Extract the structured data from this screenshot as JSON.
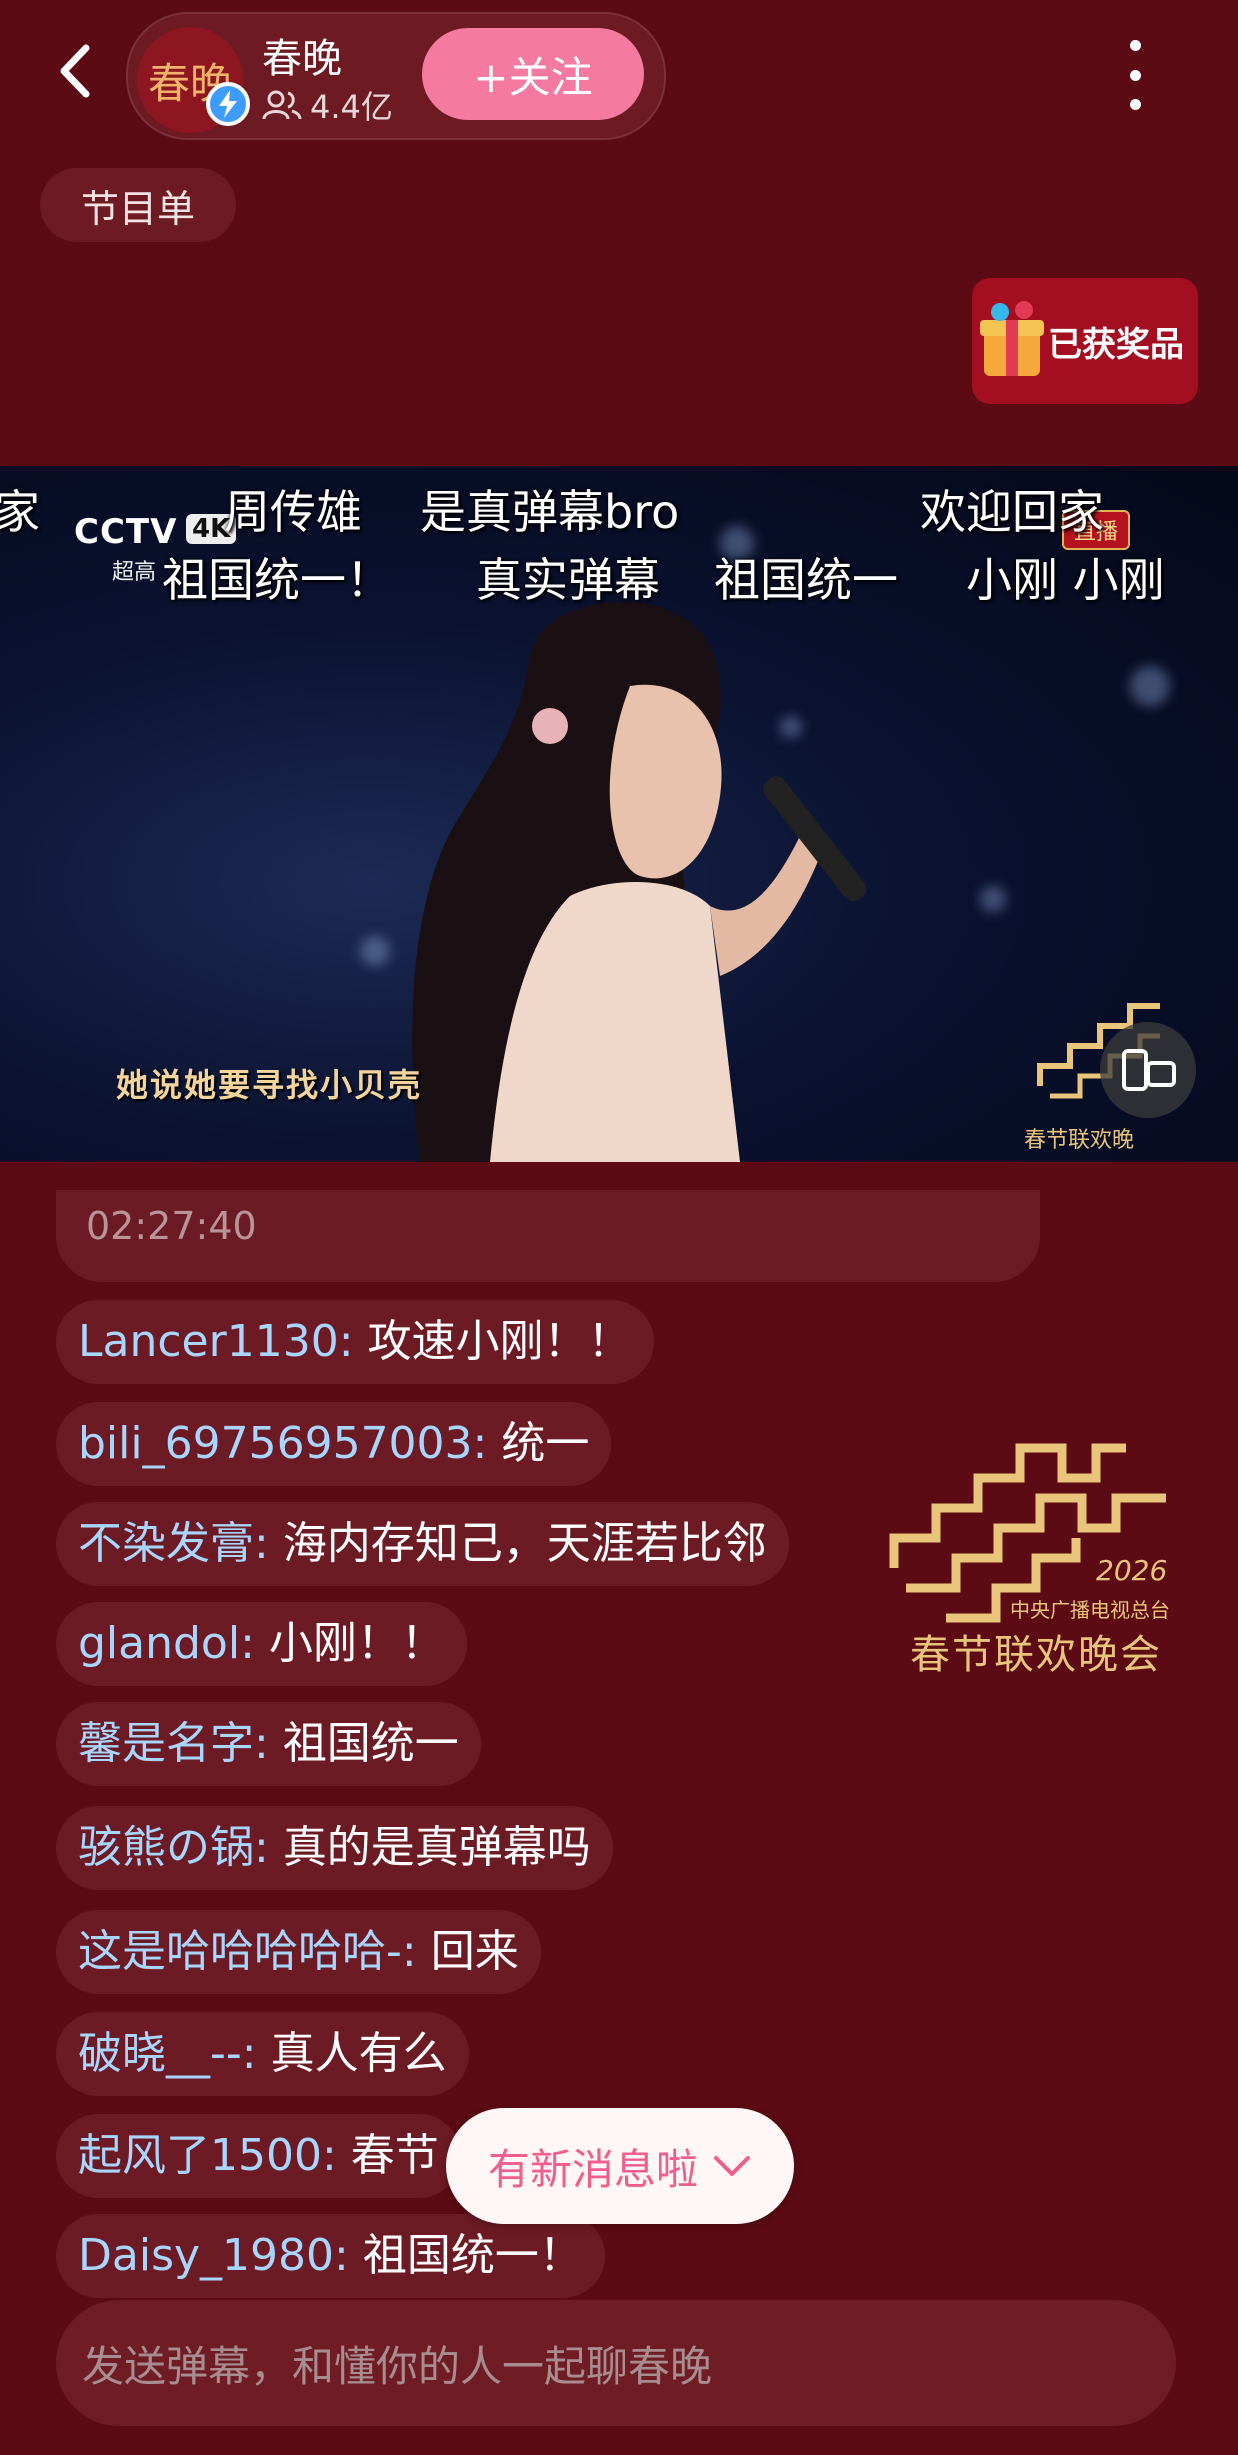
{
  "header": {
    "channel_name": "春晚",
    "avatar_text": "春晚",
    "followers": "4.4亿",
    "follow_label": "+关注"
  },
  "program_list_label": "节目单",
  "prize_label": "已获奖品",
  "video": {
    "danmaku": [
      "家",
      "周传雄",
      "是真弹幕bro",
      "欢迎回家",
      "祖国统一！",
      "真实弹幕",
      "祖国统一",
      "小刚 小刚"
    ],
    "channel_logo": "CCTV",
    "channel_logo_4k": "4K",
    "channel_logo_sub": "超高",
    "live_badge": "直播",
    "subtitle": "她说她要寻找小贝壳",
    "watermark": "春节联欢晚"
  },
  "chat": {
    "partial_timestamp": "02:27:40",
    "messages": [
      {
        "user": "Lancer1130",
        "text": "攻速小刚！！"
      },
      {
        "user": "bili_69756957003",
        "text": "统一"
      },
      {
        "user": "不染发膏",
        "text": "海内存知己，天涯若比邻"
      },
      {
        "user": "glandol",
        "text": "小刚！！"
      },
      {
        "user": "馨是名字",
        "text": "祖国统一"
      },
      {
        "user": "骇熊の锅",
        "text": "真的是真弹幕吗"
      },
      {
        "user": "这是哈哈哈哈哈-",
        "text": "回来"
      },
      {
        "user": "破晓__--",
        "text": "真人有么"
      },
      {
        "user": "起风了1500",
        "text": "春节"
      },
      {
        "user": "Daisy_1980",
        "text": "祖国统一！"
      }
    ]
  },
  "gala_logo": {
    "year": "2026",
    "org": "中央广播电视总台",
    "title": "春节联欢晚会"
  },
  "new_message_label": "有新消息啦",
  "input_placeholder": "发送弹幕，和懂你的人一起聊春晚",
  "colors": {
    "background": "#5c0b14",
    "follow_button": "#f47aa0",
    "username": "#a9d6ff",
    "gold": "#e8c57a"
  }
}
